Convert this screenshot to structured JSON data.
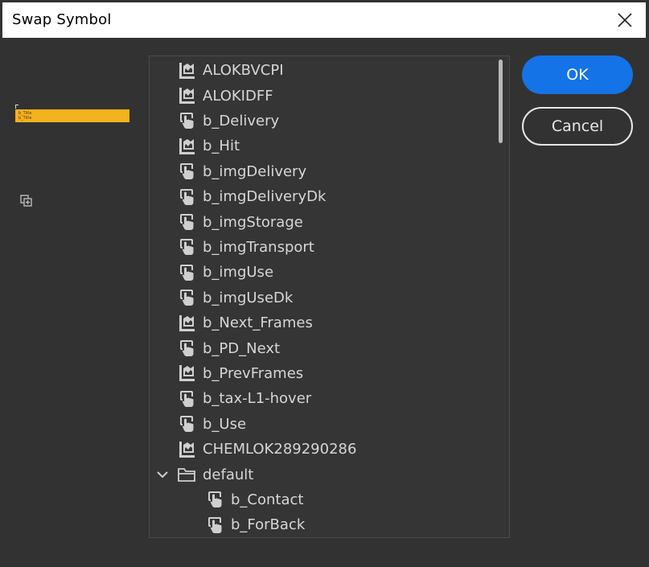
{
  "window": {
    "title": "Swap Symbol"
  },
  "buttons": {
    "ok": "OK",
    "cancel": "Cancel"
  },
  "preview": {
    "line1": "b_Title",
    "line2": "b_Title",
    "accent_color": "#f4b21f"
  },
  "symbols": [
    {
      "label": "ALOKBVCPI",
      "icon": "movieclip-icon"
    },
    {
      "label": "ALOKIDFF",
      "icon": "movieclip-icon"
    },
    {
      "label": "b_Delivery",
      "icon": "button-hand-icon"
    },
    {
      "label": "b_Hit",
      "icon": "movieclip-icon"
    },
    {
      "label": "b_imgDelivery",
      "icon": "button-hand-icon"
    },
    {
      "label": "b_imgDeliveryDk",
      "icon": "button-hand-icon"
    },
    {
      "label": "b_imgStorage",
      "icon": "button-hand-icon"
    },
    {
      "label": "b_imgTransport",
      "icon": "button-hand-icon"
    },
    {
      "label": "b_imgUse",
      "icon": "button-hand-icon"
    },
    {
      "label": "b_imgUseDk",
      "icon": "button-hand-icon"
    },
    {
      "label": "b_Next_Frames",
      "icon": "movieclip-icon"
    },
    {
      "label": "b_PD_Next",
      "icon": "button-hand-icon"
    },
    {
      "label": "b_PrevFrames",
      "icon": "movieclip-icon"
    },
    {
      "label": "b_tax-L1-hover",
      "icon": "button-hand-icon"
    },
    {
      "label": "b_Use",
      "icon": "button-hand-icon"
    },
    {
      "label": "CHEMLOK289290286",
      "icon": "movieclip-icon"
    }
  ],
  "folder": {
    "label": "default",
    "expanded": true,
    "children": [
      {
        "label": "b_Contact",
        "icon": "button-hand-icon"
      },
      {
        "label": "b_ForBack",
        "icon": "button-hand-icon"
      }
    ]
  },
  "colors": {
    "primary": "#1473e6",
    "panel": "#323232",
    "list": "#353535",
    "text": "#d6d6d6"
  }
}
